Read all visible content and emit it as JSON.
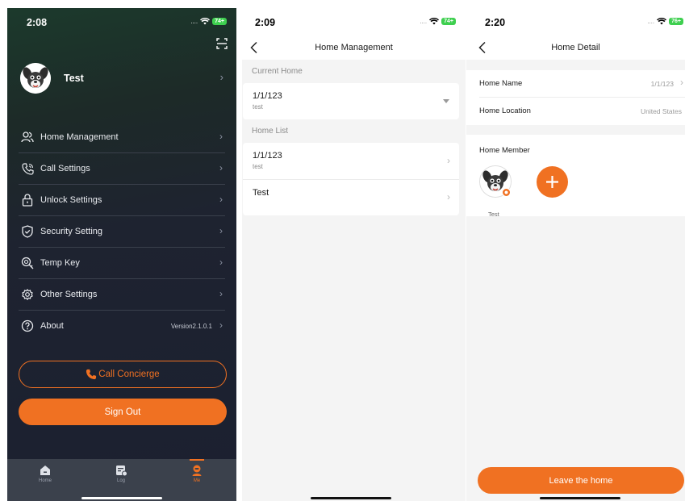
{
  "screen1": {
    "time": "2:08",
    "battery": "74+",
    "user_name": "Test",
    "menu": [
      {
        "label": "Home Management",
        "icon": "users-icon"
      },
      {
        "label": "Call Settings",
        "icon": "phone-icon"
      },
      {
        "label": "Unlock Settings",
        "icon": "lock-icon"
      },
      {
        "label": "Security Setting",
        "icon": "shield-icon"
      },
      {
        "label": "Temp Key",
        "icon": "key-icon"
      },
      {
        "label": "Other Settings",
        "icon": "gear-icon"
      },
      {
        "label": "About",
        "icon": "question-icon",
        "value": "Version2.1.0.1"
      }
    ],
    "call_concierge": "Call Concierge",
    "sign_out": "Sign Out",
    "tabs": [
      {
        "label": "Home",
        "icon": "home-icon"
      },
      {
        "label": "Log",
        "icon": "log-icon"
      },
      {
        "label": "Me",
        "icon": "profile-icon",
        "active": true
      }
    ]
  },
  "screen2": {
    "time": "2:09",
    "battery": "74+",
    "title": "Home Management",
    "current_home_label": "Current Home",
    "current_home": {
      "title": "1/1/123",
      "sub": "test"
    },
    "home_list_label": "Home List",
    "home_list": [
      {
        "title": "1/1/123",
        "sub": "test"
      },
      {
        "title": "Test",
        "sub": ""
      }
    ]
  },
  "screen3": {
    "time": "2:20",
    "battery": "76+",
    "title": "Home Detail",
    "home_name_label": "Home Name",
    "home_name_value": "1/1/123",
    "home_location_label": "Home Location",
    "home_location_value": "United States",
    "member_label": "Home Member",
    "members": [
      {
        "name": "Test"
      }
    ],
    "leave_button": "Leave the home"
  },
  "colors": {
    "accent": "#f07122",
    "dark_bg": "#1e2330",
    "tabbar": "#3b414c",
    "light_bg": "#f4f4f4"
  }
}
